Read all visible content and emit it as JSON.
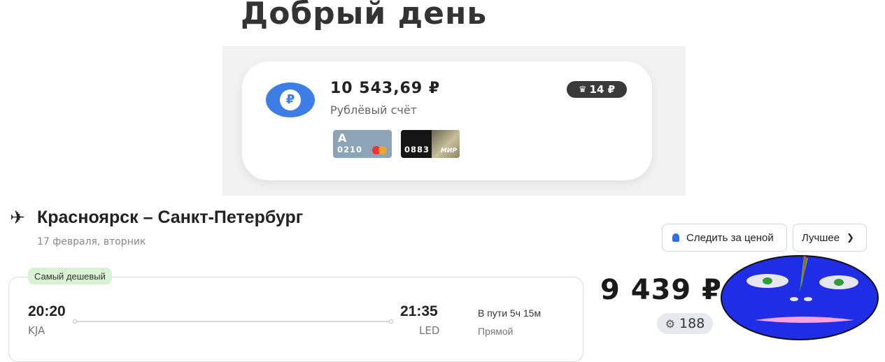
{
  "greeting": "Добрый день",
  "account": {
    "balance": "10 543,69 ₽",
    "name": "Рублёвый счёт",
    "cashback": "14 ₽",
    "currency_symbol": "₽",
    "cards": [
      {
        "letter": "A",
        "number": "0210",
        "system": "mastercard"
      },
      {
        "number": "0883",
        "system_label": "МИР"
      }
    ]
  },
  "flight": {
    "route_title": "Красноярск – Санкт-Петербург",
    "date": "17 февраля, вторник",
    "track_price_label": "Следить за ценой",
    "sort_label": "Лучшее",
    "badge": "Самый дешевый",
    "departure_time": "20:20",
    "departure_code": "KJA",
    "arrival_time": "21:35",
    "arrival_code": "LED",
    "duration": "В пути 5ч 15м",
    "stops": "Прямой",
    "price": "9 439 ₽",
    "bonus": "188"
  },
  "colors": {
    "accent_blue": "#3d7ee6",
    "badge_green": "#d8f2d3",
    "face_blue": "#1f2ee6"
  }
}
